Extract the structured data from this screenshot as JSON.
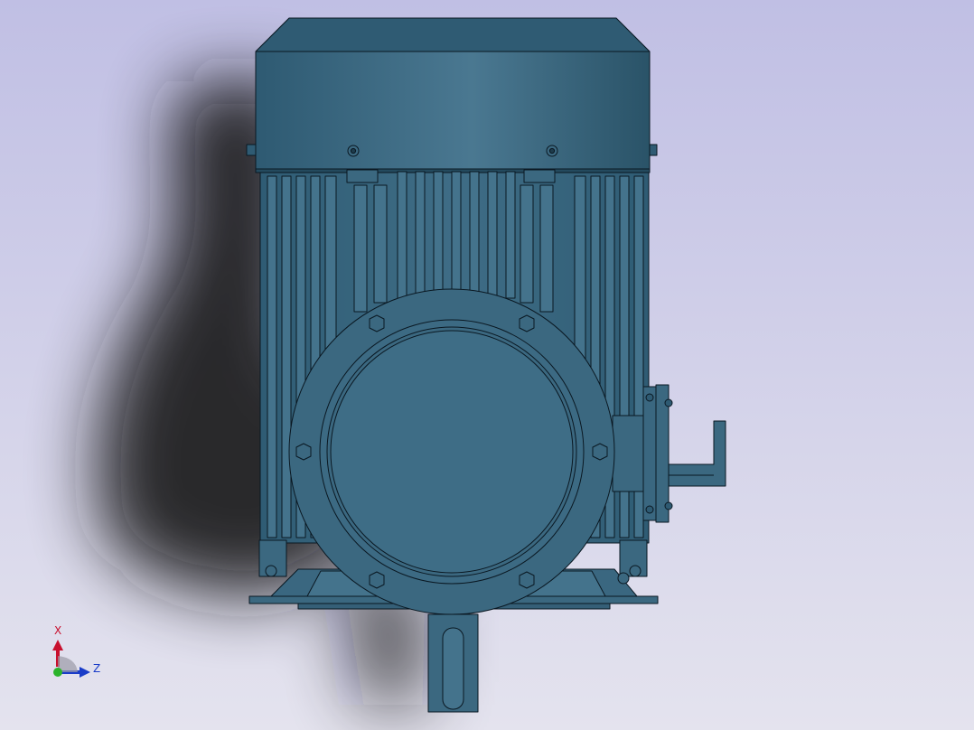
{
  "colors": {
    "background_top": "#c0bfe4",
    "background_bottom": "#e4e3ee",
    "motor_body": "#3b6880",
    "motor_highlight": "#4c7c96",
    "motor_dark": "#2e5a72",
    "edge": "#0a1822",
    "shadow": "#151518",
    "axis_x": "#c8102e",
    "axis_y": "#2bb32b",
    "axis_z": "#1a3cc8"
  },
  "triad": {
    "x_label": "X",
    "z_label": "Z"
  }
}
